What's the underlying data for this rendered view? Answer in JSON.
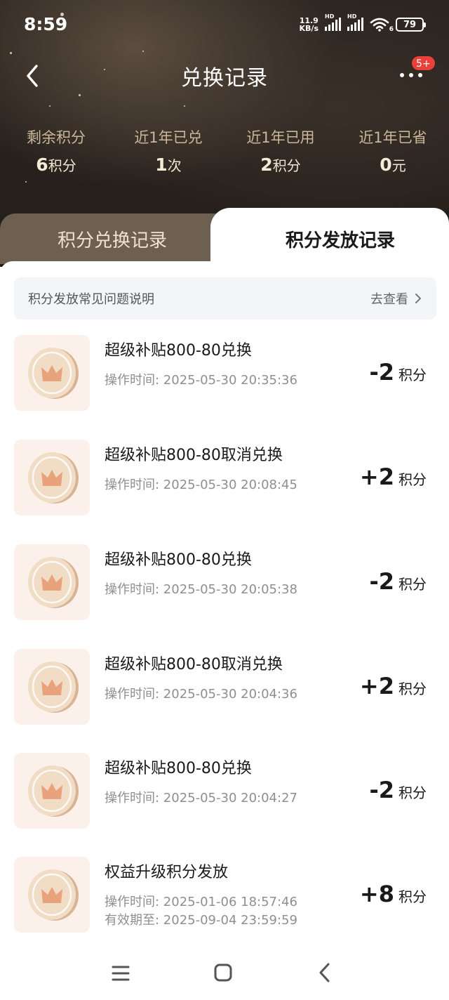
{
  "status_bar": {
    "time": "8:59",
    "net_speed_value": "11.9",
    "net_speed_unit": "KB/s",
    "signal_tag_1": "HD",
    "signal_tag_2": "HD",
    "wifi_tag": "6",
    "battery": "79"
  },
  "header": {
    "title": "兑换记录",
    "back_icon": "chevron-left-icon",
    "more_icon": "more-horizontal-icon",
    "badge": "5+"
  },
  "stats": [
    {
      "label": "剩余积分",
      "value": "6",
      "unit": "积分"
    },
    {
      "label": "近1年已兑",
      "value": "1",
      "unit": "次"
    },
    {
      "label": "近1年已用",
      "value": "2",
      "unit": "积分"
    },
    {
      "label": "近1年已省",
      "value": "0",
      "unit": "元"
    }
  ],
  "tabs": [
    {
      "label": "积分兑换记录",
      "active": false
    },
    {
      "label": "积分发放记录",
      "active": true
    }
  ],
  "faq": {
    "title": "积分发放常见问题说明",
    "link": "去查看"
  },
  "records": [
    {
      "title": "超级补贴800-80兑换",
      "time": "操作时间: 2025-05-30 20:35:36",
      "amount": "-2",
      "unit": "积分"
    },
    {
      "title": "超级补贴800-80取消兑换",
      "time": "操作时间: 2025-05-30 20:08:45",
      "amount": "+2",
      "unit": "积分"
    },
    {
      "title": "超级补贴800-80兑换",
      "time": "操作时间: 2025-05-30 20:05:38",
      "amount": "-2",
      "unit": "积分"
    },
    {
      "title": "超级补贴800-80取消兑换",
      "time": "操作时间: 2025-05-30 20:04:36",
      "amount": "+2",
      "unit": "积分"
    },
    {
      "title": "超级补贴800-80兑换",
      "time": "操作时间: 2025-05-30 20:04:27",
      "amount": "-2",
      "unit": "积分"
    },
    {
      "title": "权益升级积分发放",
      "time": "操作时间: 2025-01-06 18:57:46",
      "expire": "有效期至: 2025-09-04 23:59:59",
      "amount": "+8",
      "unit": "积分"
    }
  ],
  "colors": {
    "hero_bg": "#2b241f",
    "accent_gold": "#f2e6d2",
    "badge_red": "#e8403a",
    "coin_bg": "#fbf1ea"
  }
}
